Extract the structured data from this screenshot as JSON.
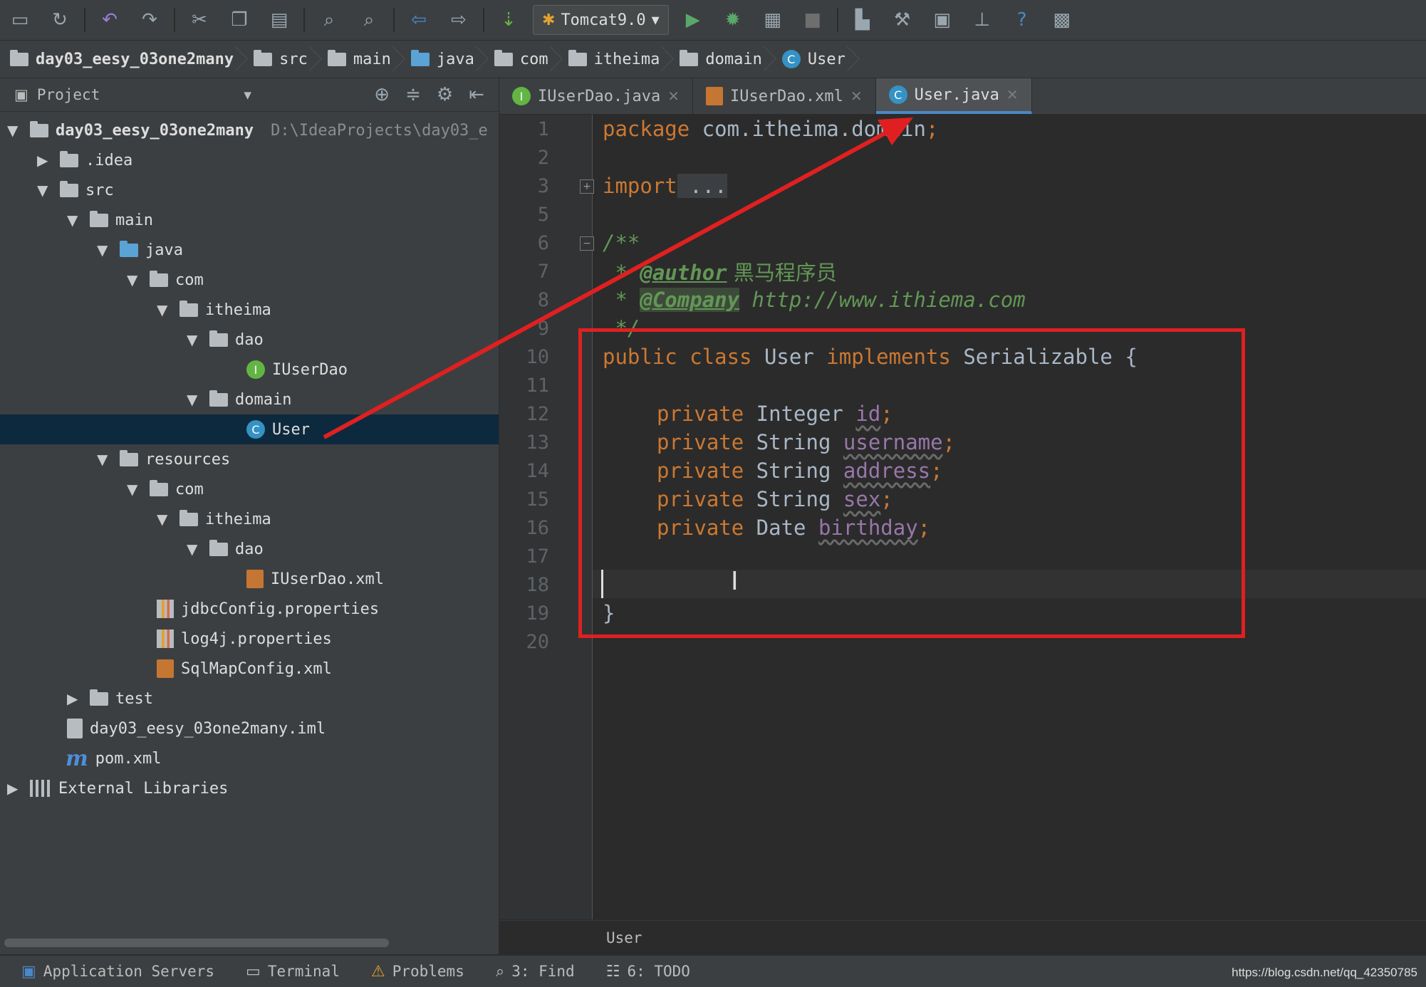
{
  "toolbar": {
    "run_config": "Tomcat9.0",
    "icons": [
      "save-icon",
      "sync-icon",
      "undo-icon",
      "redo-icon",
      "cut-icon",
      "copy-icon",
      "paste-icon",
      "find-icon",
      "replace-icon",
      "back-icon",
      "forward-icon",
      "build-icon",
      "run-config-icon",
      "run-icon",
      "debug-icon",
      "coverage-icon",
      "stop-icon",
      "project-structure-icon",
      "settings-icon",
      "sdk-icon",
      "vcs-icon",
      "help-icon",
      "tasks-icon"
    ],
    "help_glyph": "?"
  },
  "breadcrumb": [
    "day03_eesy_03one2many",
    "src",
    "main",
    "java",
    "com",
    "itheima",
    "domain",
    "User"
  ],
  "sidebar": {
    "title": "Project",
    "tree": [
      {
        "label": "day03_eesy_03one2many",
        "sub": "D:\\IdeaProjects\\day03_e",
        "arrow": "▼"
      },
      {
        "label": ".idea",
        "arrow": "▶"
      },
      {
        "label": "src",
        "arrow": "▼"
      },
      {
        "label": "main",
        "arrow": "▼"
      },
      {
        "label": "java",
        "arrow": "▼"
      },
      {
        "label": "com",
        "arrow": "▼"
      },
      {
        "label": "itheima",
        "arrow": "▼"
      },
      {
        "label": "dao",
        "arrow": "▼"
      },
      {
        "label": "IUserDao",
        "icon_letter": "I"
      },
      {
        "label": "domain",
        "arrow": "▼"
      },
      {
        "label": "User",
        "icon_letter": "C"
      },
      {
        "label": "resources",
        "arrow": "▼"
      },
      {
        "label": "com",
        "arrow": "▼"
      },
      {
        "label": "itheima",
        "arrow": "▼"
      },
      {
        "label": "dao",
        "arrow": "▼"
      },
      {
        "label": "IUserDao.xml"
      },
      {
        "label": "jdbcConfig.properties"
      },
      {
        "label": "log4j.properties"
      },
      {
        "label": "SqlMapConfig.xml"
      },
      {
        "label": "test",
        "arrow": "▶"
      },
      {
        "label": "day03_eesy_03one2many.iml"
      },
      {
        "label": "pom.xml",
        "icon_glyph": "m"
      },
      {
        "label": "External Libraries",
        "arrow": "▶"
      }
    ]
  },
  "tabs": [
    {
      "label": "IUserDao.java",
      "icon_letter": "I"
    },
    {
      "label": "IUserDao.xml"
    },
    {
      "label": "User.java",
      "icon_letter": "C"
    }
  ],
  "editor": {
    "line_numbers": [
      "1",
      "2",
      "3",
      "5",
      "6",
      "7",
      "8",
      "9",
      "10",
      "11",
      "12",
      "13",
      "14",
      "15",
      "16",
      "17",
      "18",
      "19",
      "20"
    ],
    "package_kw": "package",
    "package_name": " com.itheima.domain",
    "semicolon": ";",
    "import_kw": "import",
    "import_folded": " ...",
    "doc_open": "/**",
    "doc_star": " * ",
    "author_tag": "@author",
    "author_value": " 黑马程序员",
    "company_tag": "@Company",
    "company_value": " http://www.ithiema.com",
    "doc_close": " */",
    "class_kw": "public class",
    "class_name": " User ",
    "implements_kw": "implements",
    "iface": " Serializable {",
    "fields": [
      {
        "mod": "private",
        "type": " Integer ",
        "name": "id"
      },
      {
        "mod": "private",
        "type": " String ",
        "name": "username"
      },
      {
        "mod": "private",
        "type": " String ",
        "name": "address"
      },
      {
        "mod": "private",
        "type": " String ",
        "name": "sex"
      },
      {
        "mod": "private",
        "type": " Date ",
        "name": "birthday"
      }
    ],
    "close_brace": "}"
  },
  "bottom_crumb": "User",
  "status": {
    "items": [
      {
        "label": "Application Servers"
      },
      {
        "label": "Terminal"
      },
      {
        "label": "Problems"
      },
      {
        "label": "3: Find"
      },
      {
        "label": "6: TODO"
      }
    ],
    "watermark": "https://blog.csdn.net/qq_42350785"
  },
  "colors": {
    "annotation": "#e02020",
    "selection": "#0d293e",
    "accent": "#4a88c7"
  }
}
